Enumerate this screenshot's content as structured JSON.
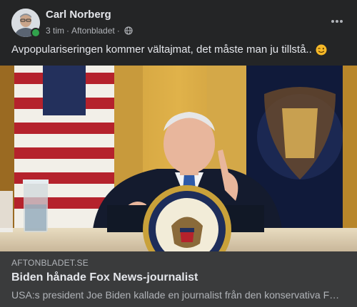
{
  "post": {
    "author": "Carl Norberg",
    "time": "3 tim",
    "source": "Aftonbladet",
    "separator": "·",
    "audience_icon": "globe-icon",
    "more_icon": "more-options-icon",
    "caption": "Avpopulariseringen kommer vältajmat, det måste man ju tillstå..",
    "caption_emoji": "winking-face-icon",
    "author_online": true
  },
  "link_preview": {
    "domain": "AFTONBLADET.SE",
    "title": "Biden hånade Fox News-journalist",
    "description": "USA:s president Joe Biden kallade en journalist från den konservativa Fox News-kanalen"
  },
  "colors": {
    "background": "#242526",
    "link_box": "#3a3b3c",
    "primary_text": "#e4e6eb",
    "secondary_text": "#b0b3b8",
    "online": "#31a24c"
  }
}
